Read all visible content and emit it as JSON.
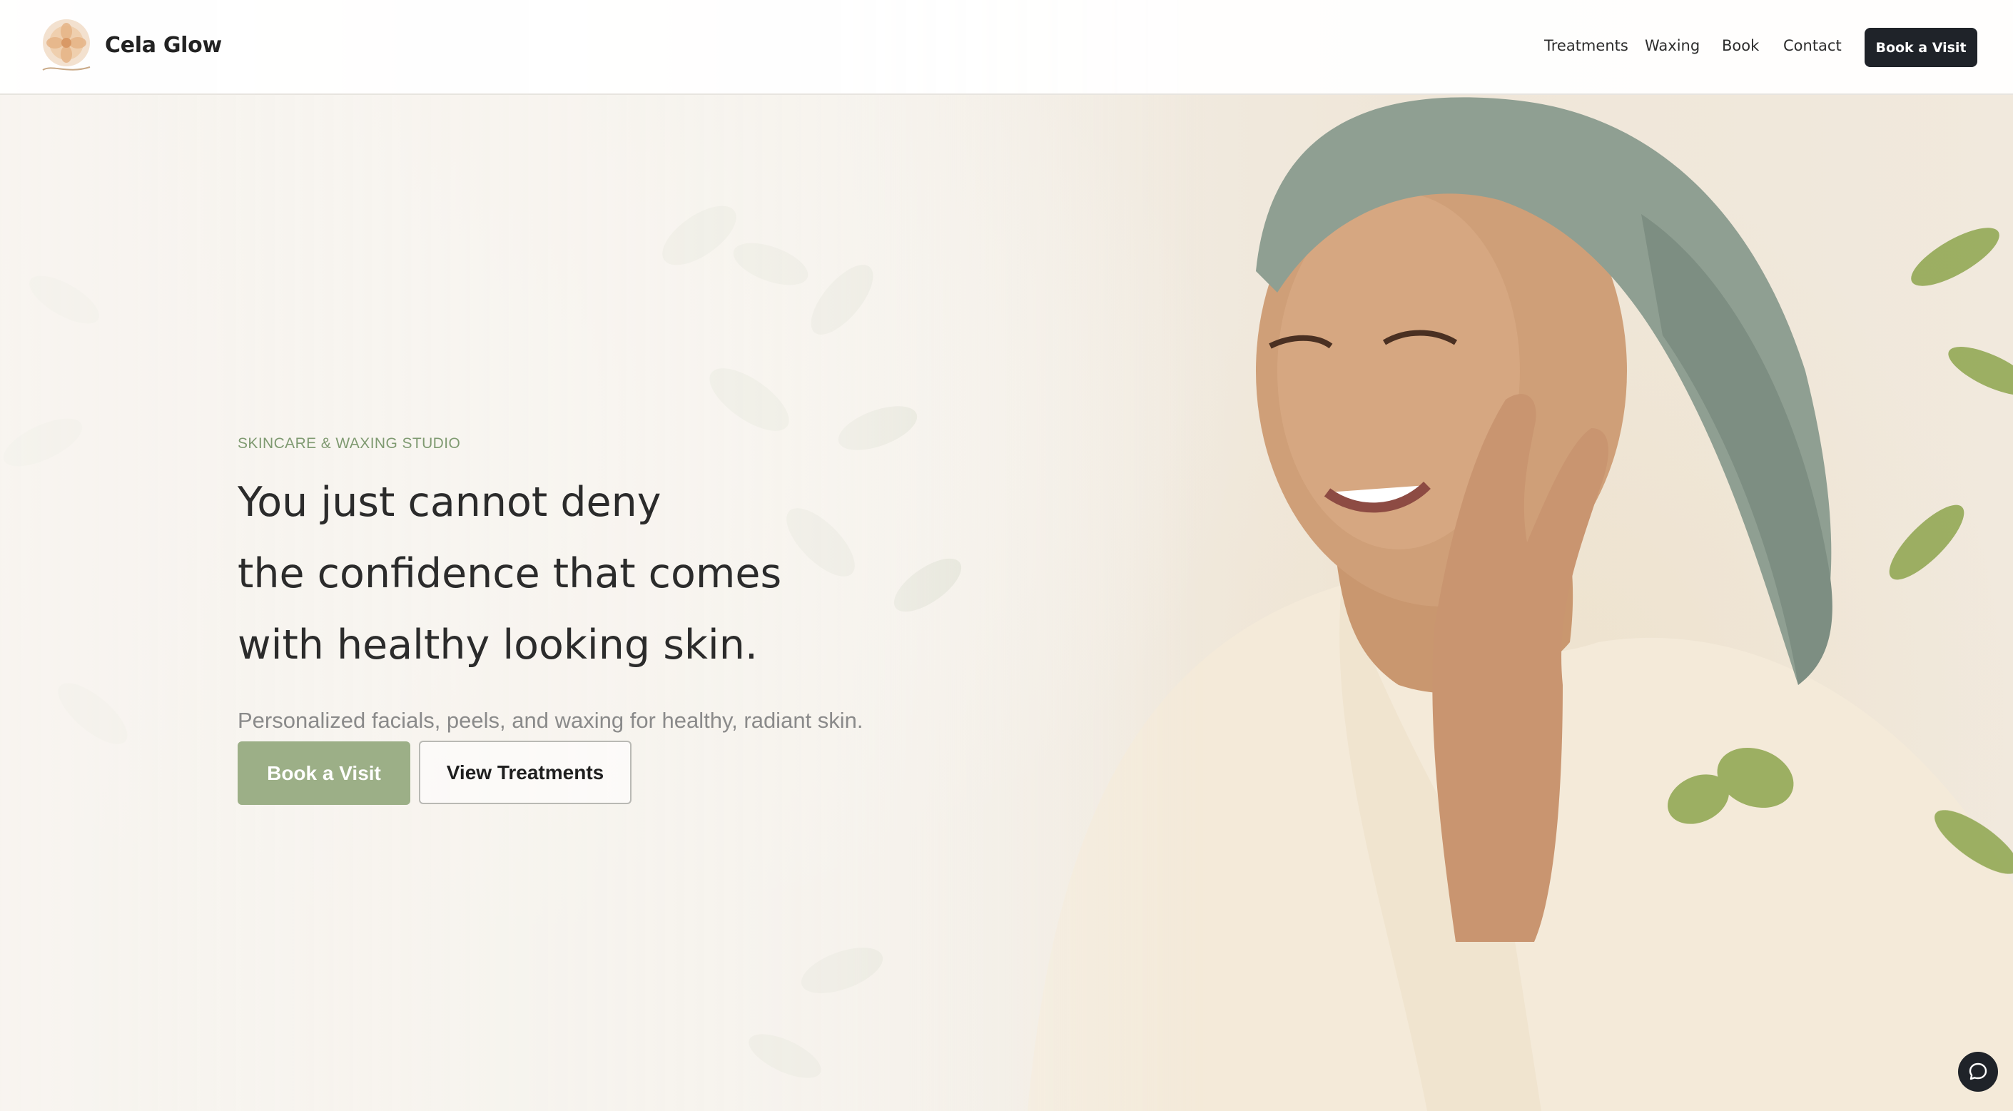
{
  "brand": {
    "name": "Cela Glow",
    "logo_icon": "floral-logo-icon"
  },
  "nav": {
    "links": [
      "Treatments",
      "Waxing",
      "Book",
      "Contact"
    ],
    "cta_label": "Book a Visit"
  },
  "hero": {
    "eyebrow": "SKINCARE & WAXING STUDIO",
    "headline_lines": [
      "You just cannot deny",
      "the confidence that comes",
      "with healthy looking skin."
    ],
    "subtitle": "Personalized facials, peels, and waxing for healthy, radiant skin.",
    "primary_button": "Book a Visit",
    "secondary_button": "View Treatments"
  },
  "chat": {
    "icon": "chat-bubble-icon"
  },
  "colors": {
    "accent_green": "#9caf87",
    "eyebrow_green": "#7f9a71",
    "dark": "#1f2329"
  }
}
